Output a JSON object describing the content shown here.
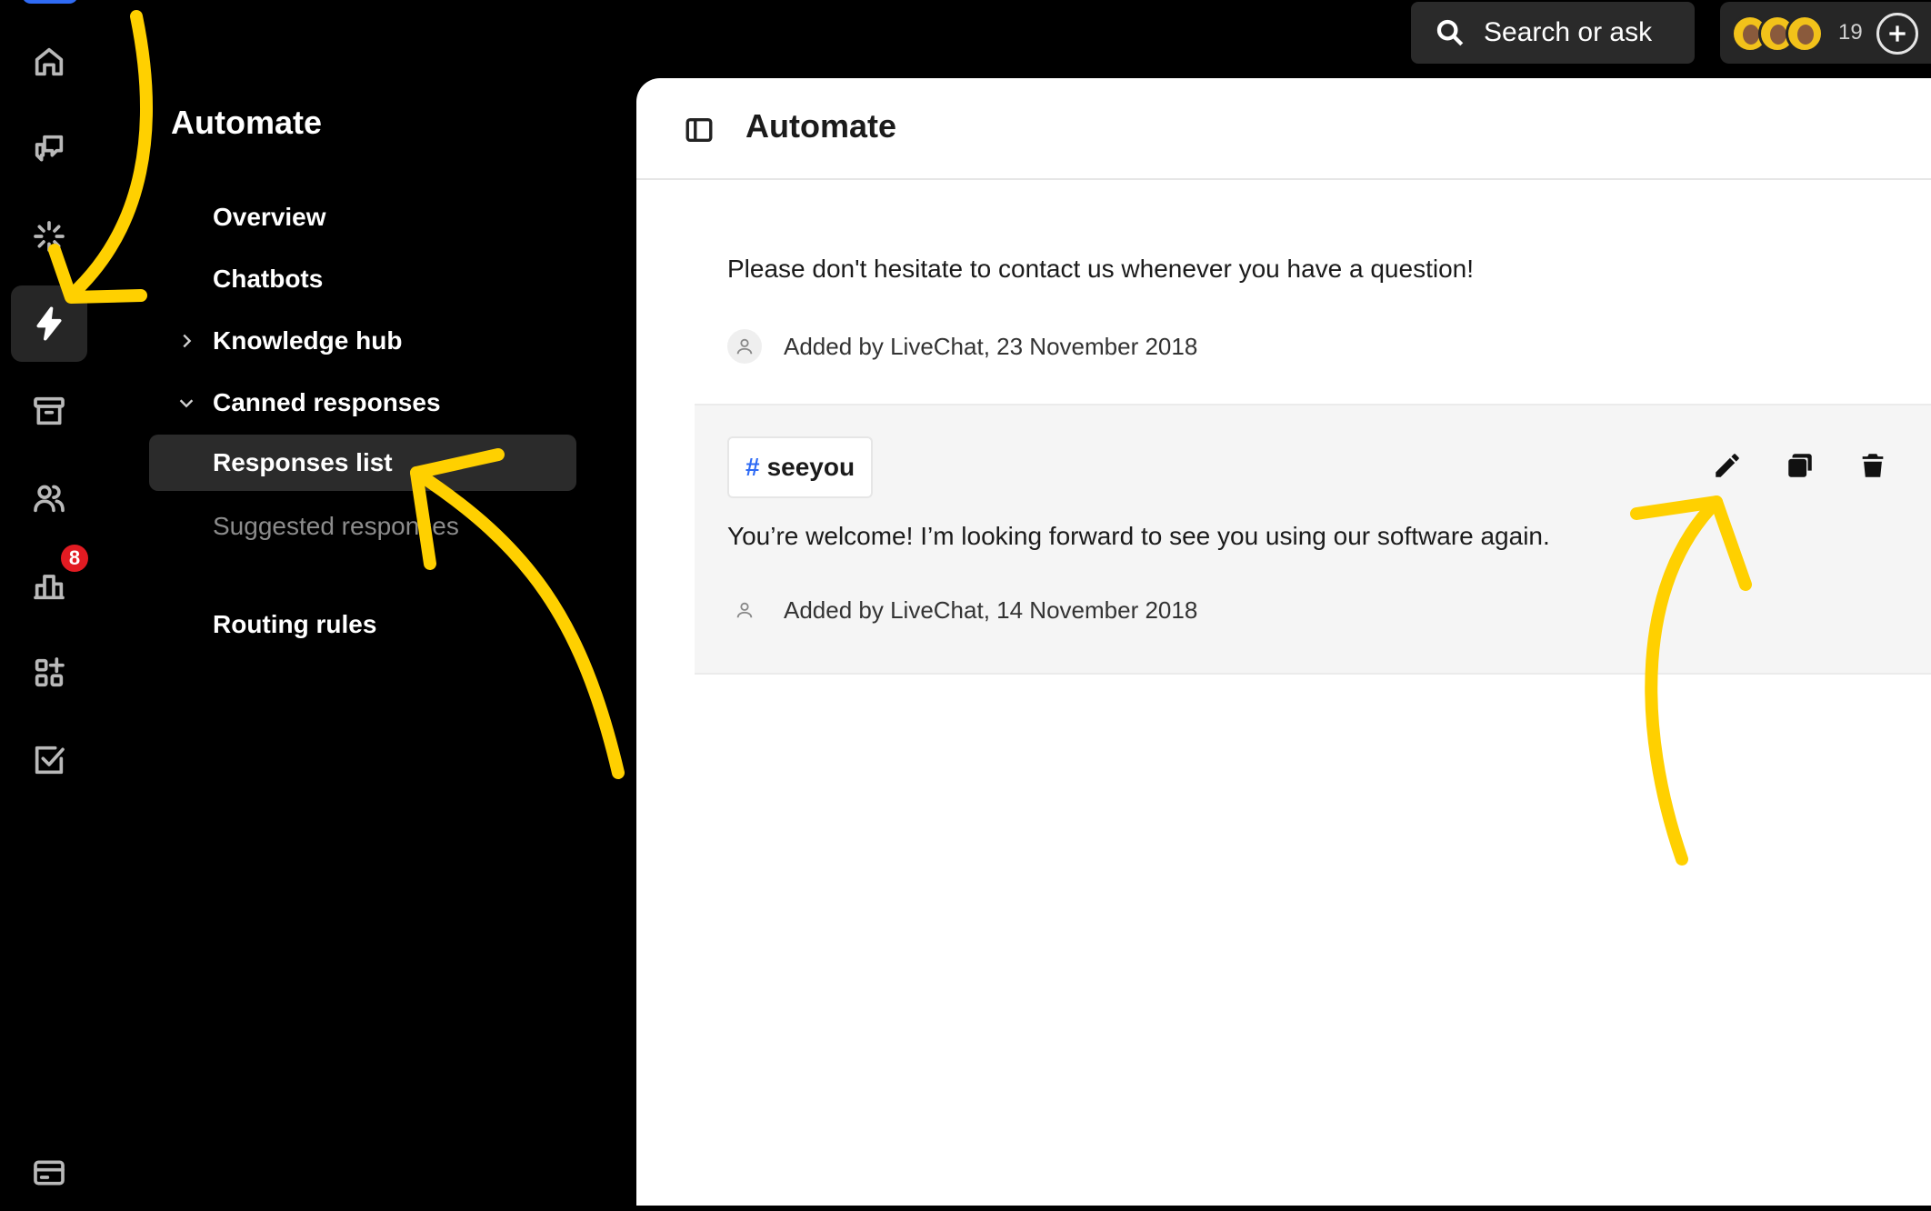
{
  "colors": {
    "accent": "#2f6bf5",
    "badge": "#e21b22",
    "annotation": "#ffd000"
  },
  "rail": {
    "items": [
      {
        "icon": "home-icon"
      },
      {
        "icon": "chats-icon"
      },
      {
        "icon": "loading-spark-icon"
      },
      {
        "icon": "automate-bolt-icon",
        "active": true
      },
      {
        "icon": "archive-icon"
      },
      {
        "icon": "customers-icon"
      },
      {
        "icon": "reports-icon",
        "badge": "8"
      },
      {
        "icon": "apps-icon"
      },
      {
        "icon": "tasks-icon"
      },
      {
        "icon": "billing-icon"
      }
    ],
    "reports_badge": "8"
  },
  "nav": {
    "title": "Automate",
    "items": [
      {
        "label": "Overview"
      },
      {
        "label": "Chatbots"
      },
      {
        "label": "Knowledge hub",
        "chevron": "right"
      },
      {
        "label": "Canned responses",
        "chevron": "down"
      },
      {
        "label": "Responses list",
        "active": true
      },
      {
        "label": "Suggested responses",
        "muted": true
      },
      {
        "label": "Routing rules"
      }
    ]
  },
  "topbar": {
    "search_label": "Search or ask",
    "team_count": "19"
  },
  "main": {
    "title": "Automate",
    "responses": [
      {
        "text": "Please don't hesitate to contact us whenever you have a question!",
        "meta": "Added by LiveChat, 23 November 2018"
      },
      {
        "shortcut_hash": "#",
        "shortcut": "seeyou",
        "text": "You’re welcome! I’m looking forward to see you using our software again.",
        "meta": "Added by LiveChat, 14 November 2018",
        "actions": [
          "edit-icon",
          "copy-icon",
          "delete-icon"
        ]
      }
    ]
  }
}
